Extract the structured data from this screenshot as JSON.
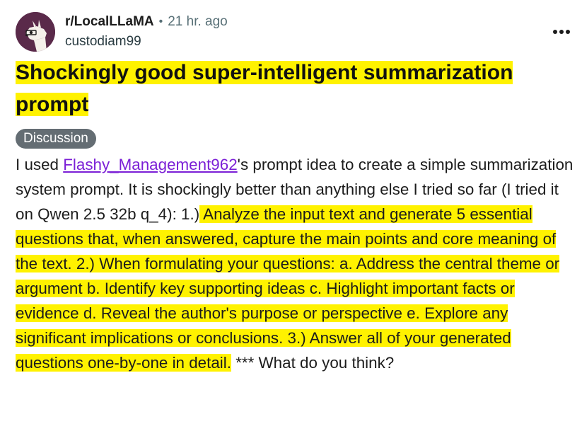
{
  "post": {
    "subreddit": "r/LocalLLaMA",
    "separator": "•",
    "time": "21 hr. ago",
    "author": "custodiam99",
    "more_icon": "more-horizontal-icon",
    "avatar_icon": "llama-avatar-icon",
    "title": "Shockingly good super-intelligent summarization prompt",
    "flair": "Discussion",
    "body": {
      "pre_link": "I used ",
      "link_text": "Flashy_Management962",
      "post_link": "'s prompt idea to create a simple summarization system prompt. It is shockingly better than anything else I tried so far (I tried it on Qwen 2.5 32b q_4): 1.)",
      "highlighted": " Analyze the input text and generate 5 essential questions that, when answered, capture the main points and core meaning of the text. 2.) When formulating your questions: a. Address the central theme or argument b. Identify key supporting ideas c. Highlight important facts or evidence d. Reveal the author's purpose or perspective e. Explore any significant implications or conclusions. 3.) Answer all of your generated questions one-by-one in detail.",
      "tail": " *** What do you think?"
    }
  },
  "colors": {
    "highlight": "#fff200",
    "link": "#7b1fd6",
    "flair_bg": "#646d73",
    "avatar_bg": "#5a2a4a",
    "muted_text": "#576f76"
  }
}
